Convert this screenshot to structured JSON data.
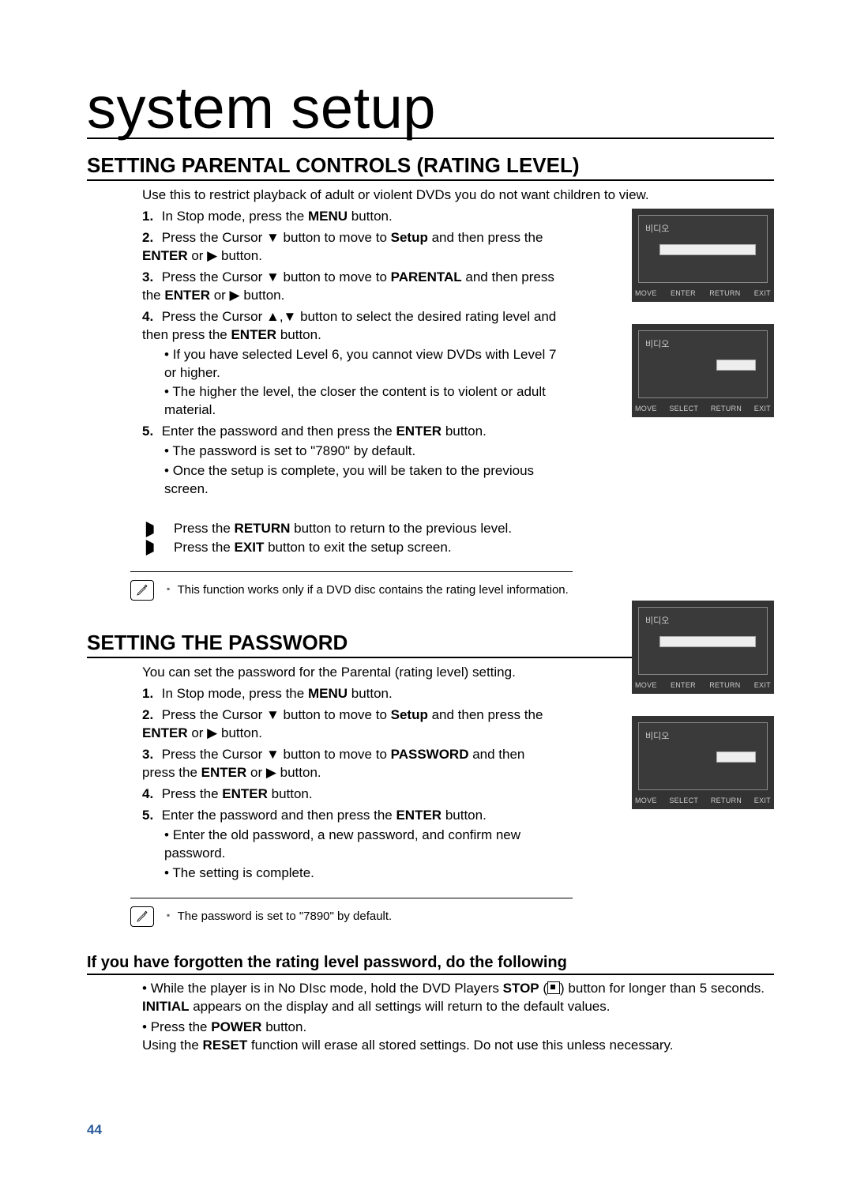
{
  "page_title": "system setup",
  "page_number": "44",
  "parental": {
    "heading": "SETTING PARENTAL CONTROLS (RATING LEVEL)",
    "intro": "Use this to restrict playback of adult or violent DVDs you do not want children to view.",
    "steps": [
      {
        "num": "1.",
        "html": "In Stop mode, press the <b>MENU</b> button."
      },
      {
        "num": "2.",
        "html": "Press the Cursor ▼ button to move to <b>Setup</b> and then press the <b>ENTER</b> or ▶ button."
      },
      {
        "num": "3.",
        "html": "Press the Cursor ▼ button to move to <b>PARENTAL</b> and then press the <b>ENTER</b> or ▶ button."
      },
      {
        "num": "4.",
        "html": "Press the Cursor ▲,▼ button to select the desired rating level and then press the <b>ENTER</b> button.",
        "bullets": [
          "If you have selected Level 6, you cannot view DVDs with Level 7 or higher.",
          "The higher the level, the closer the content is to violent or adult material."
        ]
      },
      {
        "num": "5.",
        "html": "Enter the password and then press the <b>ENTER</b> button.",
        "bullets": [
          "The password is set to \"7890\" by default.",
          "Once the setup is complete, you will be taken to the previous screen."
        ]
      }
    ],
    "arrows": [
      "Press the <b>RETURN</b> button to return to the previous level.",
      "Press the <b>EXIT</b> button to exit the setup screen."
    ],
    "note": "This function works only if a DVD disc contains the rating level information."
  },
  "password": {
    "heading": "SETTING THE PASSWORD",
    "intro": "You can set the password for the Parental (rating level) setting.",
    "steps": [
      {
        "num": "1.",
        "html": "In Stop mode, press the <b>MENU</b> button."
      },
      {
        "num": "2.",
        "html": "Press the Cursor ▼ button to move to <b>Setup</b> and then press the <b>ENTER</b> or ▶ button."
      },
      {
        "num": "3.",
        "html": "Press the Cursor ▼ button to move to <b>PASSWORD</b> and then press the <b>ENTER</b> or ▶ button."
      },
      {
        "num": "4.",
        "html": "Press the <b>ENTER</b> button."
      },
      {
        "num": "5.",
        "html": "Enter the password and then press the <b>ENTER</b> button.",
        "bullets": [
          "Enter the old password, a new password, and confirm new password.",
          "The setting is complete."
        ]
      }
    ],
    "note": "The password is set to \"7890\" by default."
  },
  "forgotten": {
    "heading": "If you have forgotten the rating level password, do the following",
    "items": [
      "While the player is in No DIsc mode, hold the DVD Players <b>STOP</b> (<span class=\"stop-square\"></span>) button for longer than 5 seconds. <b>INITIAL</b> appears on the display and all settings will return to the default values.",
      "Press the <b>POWER</b> button.<br>Using the <b>RESET</b> function will erase all stored settings. Do not use this unless necessary."
    ]
  },
  "osd": {
    "title": "비디오",
    "footers": {
      "enter": [
        "MOVE",
        "ENTER",
        "RETURN",
        "EXIT"
      ],
      "select": [
        "MOVE",
        "SELECT",
        "RETURN",
        "EXIT"
      ]
    }
  }
}
